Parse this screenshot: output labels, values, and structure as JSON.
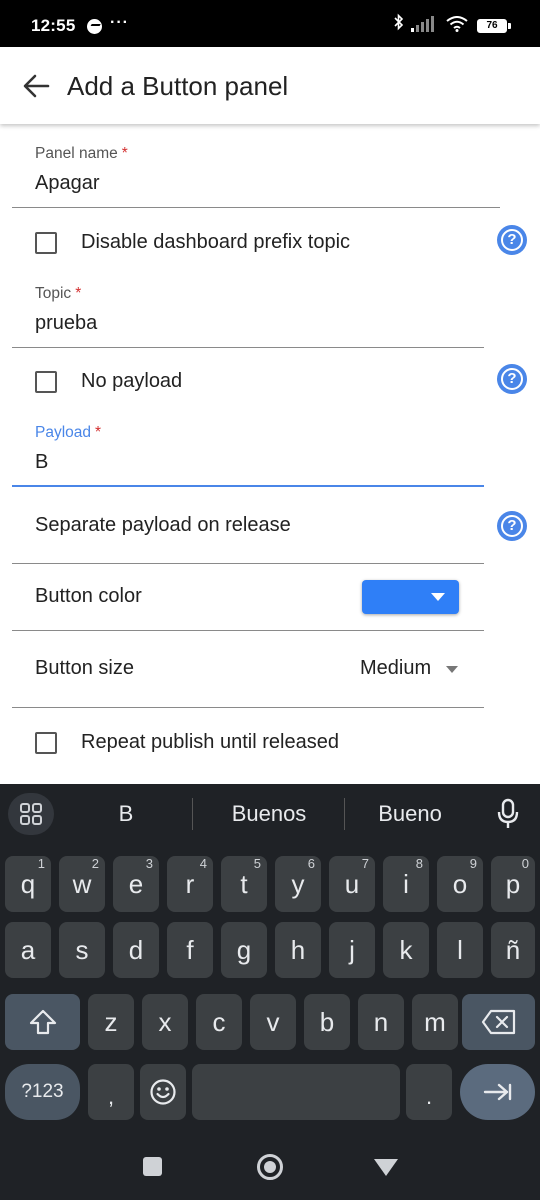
{
  "status_bar": {
    "time": "12:55",
    "dots": "···",
    "battery": "76",
    "icons": [
      "messenger-icon",
      "bluetooth-icon",
      "signal-icon",
      "wifi-icon",
      "battery-icon"
    ]
  },
  "app_bar": {
    "title": "Add a Button panel",
    "back_icon": "arrow-back-icon"
  },
  "form": {
    "panel_name": {
      "label": "Panel name",
      "required": "*",
      "value": "Apagar"
    },
    "disable_prefix": {
      "label": "Disable dashboard prefix topic",
      "checked": false
    },
    "topic": {
      "label": "Topic",
      "required": "*",
      "value": "prueba"
    },
    "no_payload": {
      "label": "No payload",
      "checked": false
    },
    "payload": {
      "label": "Payload",
      "required": "*",
      "value": "B",
      "focused": true
    },
    "separate_payload": {
      "label": "Separate payload on release"
    },
    "button_color": {
      "label": "Button color",
      "color": "#2f7ff7"
    },
    "button_size": {
      "label": "Button size",
      "value": "Medium"
    },
    "repeat_publish": {
      "label": "Repeat publish until released",
      "checked": false
    },
    "help_icon": "?",
    "accent_color": "#4a86e8"
  },
  "keyboard": {
    "suggestions": [
      "B",
      "Buenos",
      "Bueno"
    ],
    "row1": [
      {
        "k": "q",
        "h": "1"
      },
      {
        "k": "w",
        "h": "2"
      },
      {
        "k": "e",
        "h": "3"
      },
      {
        "k": "r",
        "h": "4"
      },
      {
        "k": "t",
        "h": "5"
      },
      {
        "k": "y",
        "h": "6"
      },
      {
        "k": "u",
        "h": "7"
      },
      {
        "k": "i",
        "h": "8"
      },
      {
        "k": "o",
        "h": "9"
      },
      {
        "k": "p",
        "h": "0"
      }
    ],
    "row2": [
      "a",
      "s",
      "d",
      "f",
      "g",
      "h",
      "j",
      "k",
      "l",
      "ñ"
    ],
    "row3": [
      "z",
      "x",
      "c",
      "v",
      "b",
      "n",
      "m"
    ],
    "sym_label": "?123",
    "comma": ",",
    "period": ".",
    "emoji_icon": "emoji-icon",
    "enter_icon": "next-arrow-icon",
    "shift_icon": "shift-icon",
    "backspace_icon": "backspace-icon",
    "mic_icon": "mic-icon",
    "grid_icon": "apps-grid-icon"
  },
  "nav_bar": {
    "icons": [
      "recents-square-icon",
      "home-circle-icon",
      "back-triangle-icon"
    ]
  }
}
